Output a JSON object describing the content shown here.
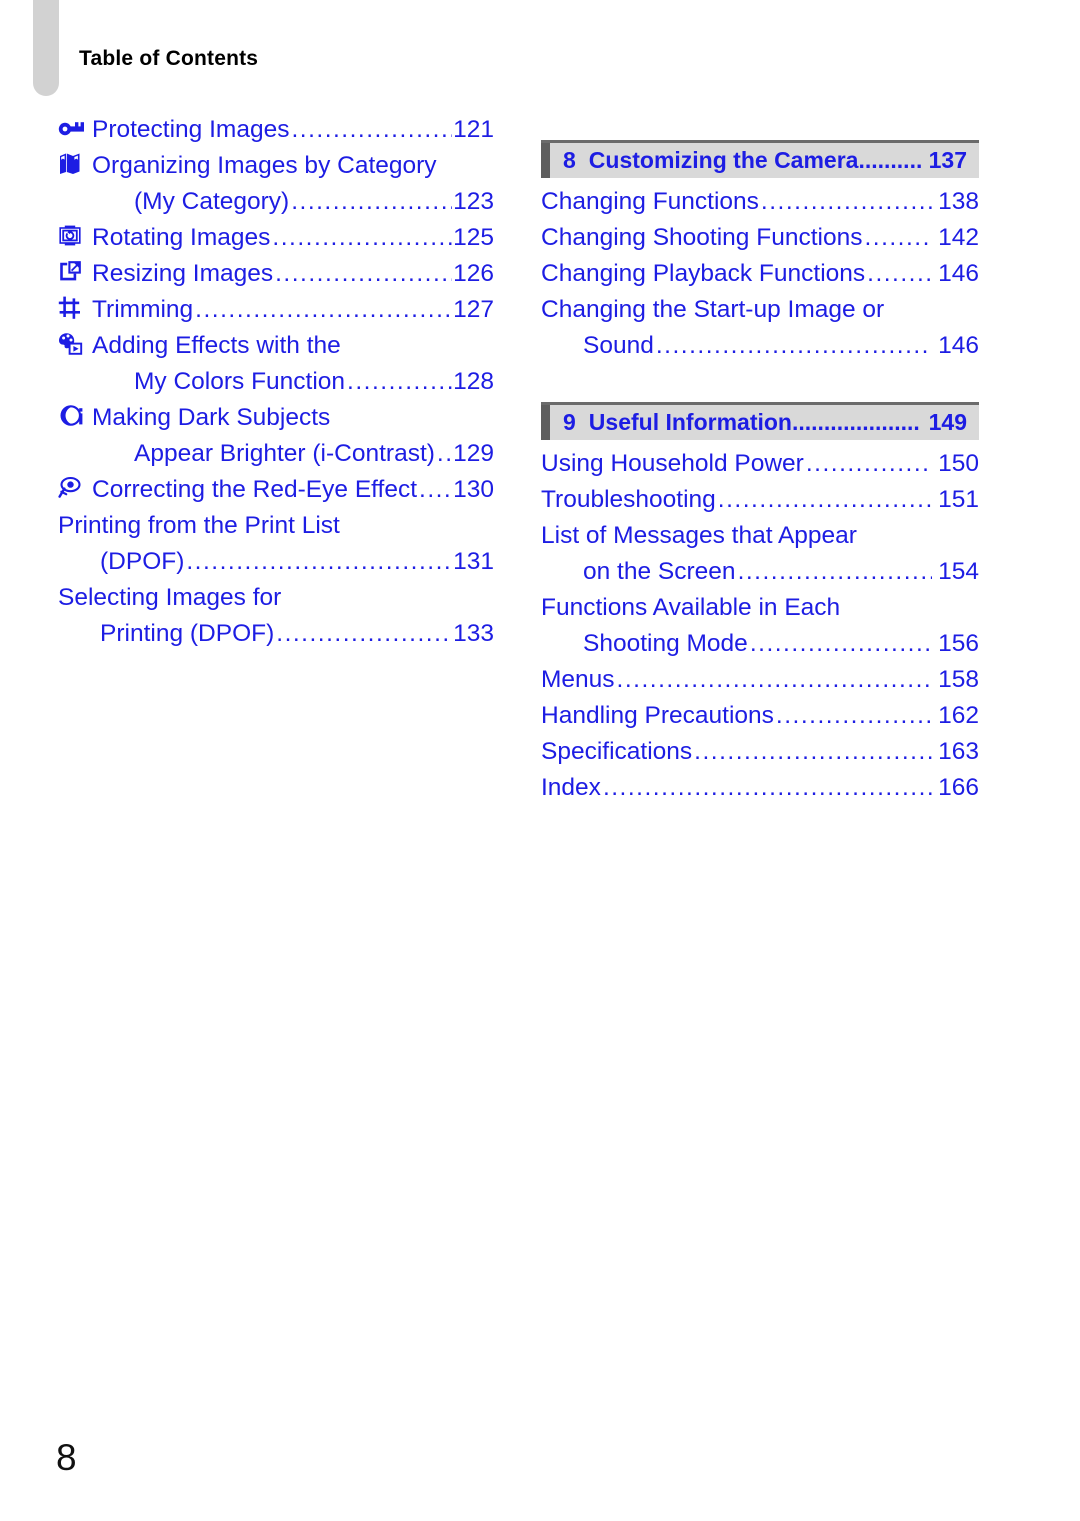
{
  "page": {
    "heading": "Table of Contents",
    "page_number": "8",
    "text_color": "#1d1de3",
    "heading_color": "#000000",
    "bar_bg_color": "#d9d9d9",
    "bar_accent_color": "#5e5e5e",
    "tab_color": "#d2d2d2"
  },
  "left_column": {
    "entries": [
      {
        "icon": "key-icon",
        "lines": [
          {
            "label": "Protecting Images",
            "dots": true,
            "page": "121",
            "indent": false
          }
        ]
      },
      {
        "icon": "books-category-icon",
        "lines": [
          {
            "label": "Organizing Images by Category",
            "dots": false,
            "page": "",
            "indent": false
          },
          {
            "label": "(My Category)",
            "dots": true,
            "page": "123",
            "indent": true
          }
        ]
      },
      {
        "icon": "rotate-icon",
        "lines": [
          {
            "label": "Rotating Images",
            "dots": true,
            "page": "125",
            "indent": false
          }
        ]
      },
      {
        "icon": "resize-icon",
        "lines": [
          {
            "label": "Resizing Images",
            "dots": true,
            "page": "126",
            "indent": false
          }
        ]
      },
      {
        "icon": "crop-icon",
        "lines": [
          {
            "label": "Trimming",
            "dots": true,
            "page": "127",
            "indent": false
          }
        ]
      },
      {
        "icon": "my-colors-icon",
        "lines": [
          {
            "label": "Adding Effects with the",
            "dots": false,
            "page": "",
            "indent": false
          },
          {
            "label": "My Colors Function",
            "dots": true,
            "page": "128",
            "indent": true
          }
        ]
      },
      {
        "icon": "i-contrast-icon",
        "lines": [
          {
            "label": "Making Dark Subjects",
            "dots": false,
            "page": "",
            "indent": false
          },
          {
            "label": "Appear Brighter (i-Contrast)",
            "dots": true,
            "page": "129",
            "indent": true
          }
        ]
      },
      {
        "icon": "red-eye-icon",
        "lines": [
          {
            "label": "Correcting the Red-Eye Effect",
            "dots": true,
            "page": "130",
            "indent": false
          }
        ]
      },
      {
        "icon": "none",
        "lines": [
          {
            "label": "Printing from the Print List",
            "dots": false,
            "page": "",
            "indent": false
          },
          {
            "label": "(DPOF)",
            "dots": true,
            "page": "131",
            "indent": true
          }
        ]
      },
      {
        "icon": "none",
        "lines": [
          {
            "label": "Selecting Images for",
            "dots": false,
            "page": "",
            "indent": false
          },
          {
            "label": "Printing (DPOF)",
            "dots": true,
            "page": "133",
            "indent": true
          }
        ]
      }
    ]
  },
  "right_column": {
    "chapters": [
      {
        "number": "8",
        "title": "Customizing the Camera",
        "page": "137",
        "entries": [
          {
            "icon": "none",
            "lines": [
              {
                "label": "Changing Functions",
                "dots": true,
                "page": "138",
                "indent": false
              }
            ]
          },
          {
            "icon": "none",
            "lines": [
              {
                "label": "Changing Shooting Functions",
                "dots": true,
                "page": "142",
                "indent": false
              }
            ]
          },
          {
            "icon": "none",
            "lines": [
              {
                "label": "Changing Playback Functions",
                "dots": true,
                "page": "146",
                "indent": false
              }
            ]
          },
          {
            "icon": "none",
            "lines": [
              {
                "label": "Changing the Start-up Image or",
                "dots": false,
                "page": "",
                "indent": false
              },
              {
                "label": "Sound",
                "dots": true,
                "page": "146",
                "indent": true
              }
            ]
          }
        ]
      },
      {
        "number": "9",
        "title": "Useful Information",
        "page": "149",
        "entries": [
          {
            "icon": "none",
            "lines": [
              {
                "label": "Using Household Power",
                "dots": true,
                "page": "150",
                "indent": false
              }
            ]
          },
          {
            "icon": "none",
            "lines": [
              {
                "label": "Troubleshooting",
                "dots": true,
                "page": "151",
                "indent": false
              }
            ]
          },
          {
            "icon": "none",
            "lines": [
              {
                "label": "List of Messages that Appear",
                "dots": false,
                "page": "",
                "indent": false
              },
              {
                "label": "on the Screen",
                "dots": true,
                "page": "154",
                "indent": true
              }
            ]
          },
          {
            "icon": "none",
            "lines": [
              {
                "label": "Functions Available in Each",
                "dots": false,
                "page": "",
                "indent": false
              },
              {
                "label": "Shooting Mode",
                "dots": true,
                "page": "156",
                "indent": true
              }
            ]
          },
          {
            "icon": "none",
            "lines": [
              {
                "label": "Menus",
                "dots": true,
                "page": "158",
                "indent": false
              }
            ]
          },
          {
            "icon": "none",
            "lines": [
              {
                "label": "Handling Precautions",
                "dots": true,
                "page": "162",
                "indent": false
              }
            ]
          },
          {
            "icon": "none",
            "lines": [
              {
                "label": "Specifications",
                "dots": true,
                "page": "163",
                "indent": false
              }
            ]
          },
          {
            "icon": "none",
            "lines": [
              {
                "label": "Index",
                "dots": true,
                "page": "166",
                "indent": false
              }
            ]
          }
        ]
      }
    ]
  }
}
